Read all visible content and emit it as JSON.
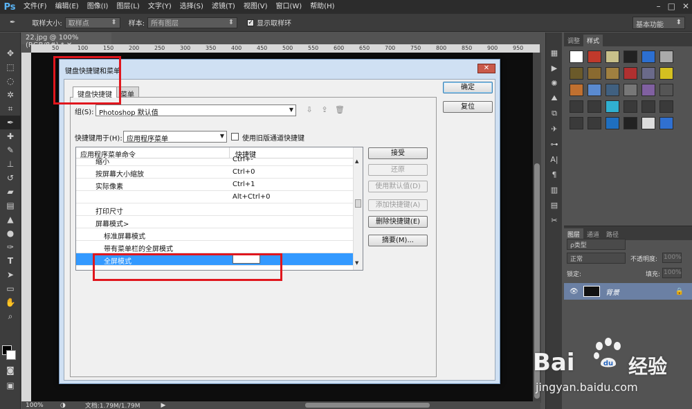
{
  "app": {
    "logo": "Ps",
    "menus": [
      "文件(F)",
      "编辑(E)",
      "图像(I)",
      "图层(L)",
      "文字(Y)",
      "选择(S)",
      "滤镜(T)",
      "视图(V)",
      "窗口(W)",
      "帮助(H)"
    ],
    "window_controls": [
      "–",
      "□",
      "✕"
    ]
  },
  "options_bar": {
    "sample_size_label": "取样大小:",
    "sample_size_value": "取样点",
    "sample_label": "样本:",
    "sample_value": "所有图层",
    "show_ring_label": "显示取样环",
    "workspace": "基本功能"
  },
  "document": {
    "tab_title": "22.jpg @ 100%(RGB/8#) *",
    "ruler_ticks": [
      "50",
      "100",
      "150",
      "200",
      "250",
      "300",
      "350",
      "400",
      "450",
      "500",
      "550",
      "600",
      "650",
      "700",
      "750",
      "800",
      "850",
      "900",
      "950"
    ],
    "zoom": "100%",
    "doc_info": "文档:1.79M/1.79M"
  },
  "panels": {
    "top_tabs": [
      "调整",
      "样式"
    ],
    "layer_tabs": [
      "图层",
      "通道",
      "路径"
    ],
    "filter_kind": "ρ类型",
    "blend_mode": "正常",
    "opacity_label": "不透明度:",
    "opacity_value": "100%",
    "lock_label": "锁定:",
    "fill_label": "填充:",
    "fill_value": "100%",
    "layer_name": "背景"
  },
  "dialog": {
    "title": "键盘快捷键和菜单",
    "close": "✕",
    "tabs": [
      "键盘快捷键",
      "菜单"
    ],
    "set_label": "组(S):",
    "set_value": "Photoshop 默认值",
    "shortcuts_for_label": "快捷键用于(H):",
    "shortcuts_for_value": "应用程序菜单",
    "legacy_channel_label": "使用旧版通道快捷键",
    "col_command": "应用程序菜单命令",
    "col_shortcut": "快捷键",
    "rows": [
      {
        "command": "缩小",
        "shortcut": "Ctrl+-"
      },
      {
        "command": "按屏幕大小缩放",
        "shortcut": "Ctrl+0"
      },
      {
        "command": "实际像素",
        "shortcut": "Ctrl+1"
      },
      {
        "command": "",
        "shortcut": "Alt+Ctrl+0"
      },
      {
        "command": "打印尺寸",
        "shortcut": ""
      },
      {
        "command": "屏幕模式>",
        "shortcut": ""
      },
      {
        "command": "标准屏幕模式",
        "shortcut": ""
      },
      {
        "command": "带有菜单栏的全屏模式",
        "shortcut": ""
      },
      {
        "command": "全屏模式",
        "shortcut": ""
      }
    ],
    "buttons": {
      "ok": "确定",
      "reset": "复位",
      "accept": "接受",
      "undo": "还原",
      "use_default": "使用默认值(D)",
      "add_shortcut": "添加快捷键(A)",
      "delete_shortcut": "删除快捷键(E)",
      "summarize": "摘要(M)..."
    }
  },
  "watermark": {
    "brand_left": "Bai",
    "brand_right": "经验",
    "url": "jingyan.baidu.com"
  }
}
